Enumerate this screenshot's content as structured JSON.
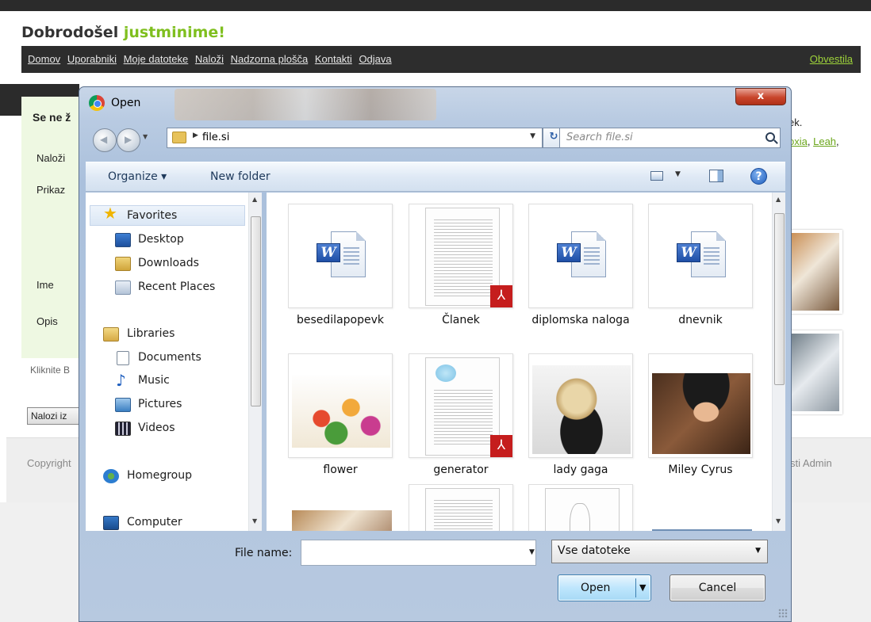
{
  "site": {
    "welcome_prefix": "Dobrodošel",
    "username": "justminime!",
    "nav": [
      "Domov",
      "Uporabniki",
      "Moje datoteke",
      "Naloži",
      "Nadzorna plošča",
      "Kontakti",
      "Odjava"
    ],
    "nav_right": "Obvestila",
    "heading_partial": "Se ne ž",
    "labels": [
      "Naloži",
      "Prikaz",
      "Ime",
      "Opis"
    ],
    "hint_partial": "Kliknite B",
    "upload_btn_partial": "Nalozi iz",
    "footer_left": "Copyright",
    "footer_right": "sti  Admin",
    "right_text_1": "ek.",
    "right_link_1": "oxia",
    "right_link_2": "Leah",
    "right_comma": ","
  },
  "dialog": {
    "title": "Open",
    "close_label": "x",
    "address": "file.si",
    "search_placeholder": "Search file.si",
    "toolbar": {
      "organize": "Organize ▾",
      "new_folder": "New folder",
      "help": "?"
    },
    "nav": {
      "favorites": "Favorites",
      "desktop": "Desktop",
      "downloads": "Downloads",
      "recent": "Recent Places",
      "libraries": "Libraries",
      "documents": "Documents",
      "music": "Music",
      "pictures": "Pictures",
      "videos": "Videos",
      "homegroup": "Homegroup",
      "computer": "Computer"
    },
    "files": [
      {
        "name": "besedilapopevk",
        "type": "word"
      },
      {
        "name": "Članek",
        "type": "pdf"
      },
      {
        "name": "diplomska naloga",
        "type": "word"
      },
      {
        "name": "dnevnik",
        "type": "word"
      },
      {
        "name": "flower",
        "type": "image"
      },
      {
        "name": "generator",
        "type": "pdf"
      },
      {
        "name": "lady gaga",
        "type": "image"
      },
      {
        "name": "Miley Cyrus",
        "type": "image"
      }
    ],
    "file_name_label": "File name:",
    "file_name_value": "",
    "filter": "Vse datoteke",
    "open_label": "Open",
    "cancel_label": "Cancel"
  }
}
